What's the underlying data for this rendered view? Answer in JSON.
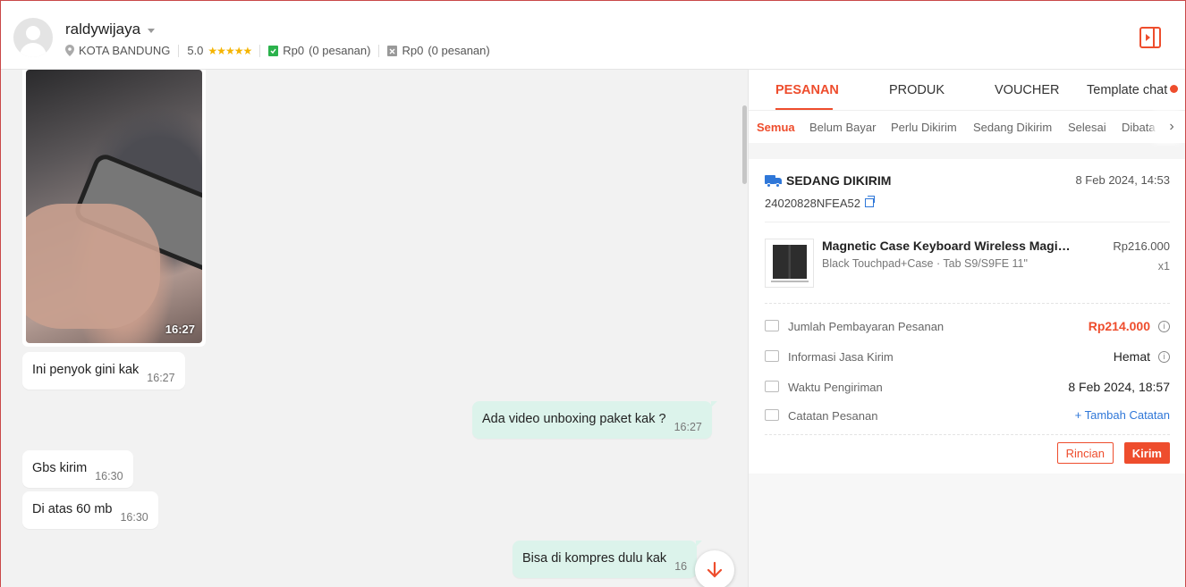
{
  "header": {
    "username": "raldywijaya",
    "location": "KOTA BANDUNG",
    "rating": "5.0",
    "stars": "★★★★★",
    "completed_amount": "Rp0",
    "completed_orders": "(0 pesanan)",
    "cancelled_amount": "Rp0",
    "cancelled_orders": "(0 pesanan)"
  },
  "chat": {
    "video_time": "16:27",
    "messages": [
      {
        "text": "Ini penyok gini kak",
        "time": "16:27",
        "dir": "in"
      },
      {
        "text": "Ada video unboxing paket kak ?",
        "time": "16:27",
        "dir": "out"
      },
      {
        "text": "Gbs kirim",
        "time": "16:30",
        "dir": "in"
      },
      {
        "text": "Di atas 60 mb",
        "time": "16:30",
        "dir": "in"
      },
      {
        "text": "Bisa di kompres dulu kak",
        "time": "16",
        "dir": "out"
      }
    ]
  },
  "panel": {
    "tabs": [
      "PESANAN",
      "PRODUK",
      "VOUCHER",
      "Template chat"
    ],
    "subtabs": [
      "Semua",
      "Belum Bayar",
      "Perlu Dikirim",
      "Sedang Dikirim",
      "Selesai",
      "Dibata"
    ],
    "order": {
      "status": "SEDANG DIKIRIM",
      "date": "8 Feb 2024, 14:53",
      "id": "24020828NFEA52",
      "product_name": "Magnetic Case Keyboard Wireless Magic...",
      "product_variant": "Black Touchpad+Case · Tab S9/S9FE 11\"",
      "product_price": "Rp216.000",
      "product_qty": "x1",
      "payment_label": "Jumlah Pembayaran Pesanan",
      "payment_value": "Rp214.000",
      "shipping_label": "Informasi Jasa Kirim",
      "shipping_value": "Hemat",
      "ship_time_label": "Waktu Pengiriman",
      "ship_time_value": "8 Feb 2024, 18:57",
      "note_label": "Catatan Pesanan",
      "note_action": "+ Tambah Catatan",
      "detail_button": "Rincian",
      "send_button": "Kirim"
    }
  },
  "colors": {
    "accent": "#ee4d2d",
    "link": "#2f77d8",
    "outgoing_bubble": "#dcf3eb"
  }
}
